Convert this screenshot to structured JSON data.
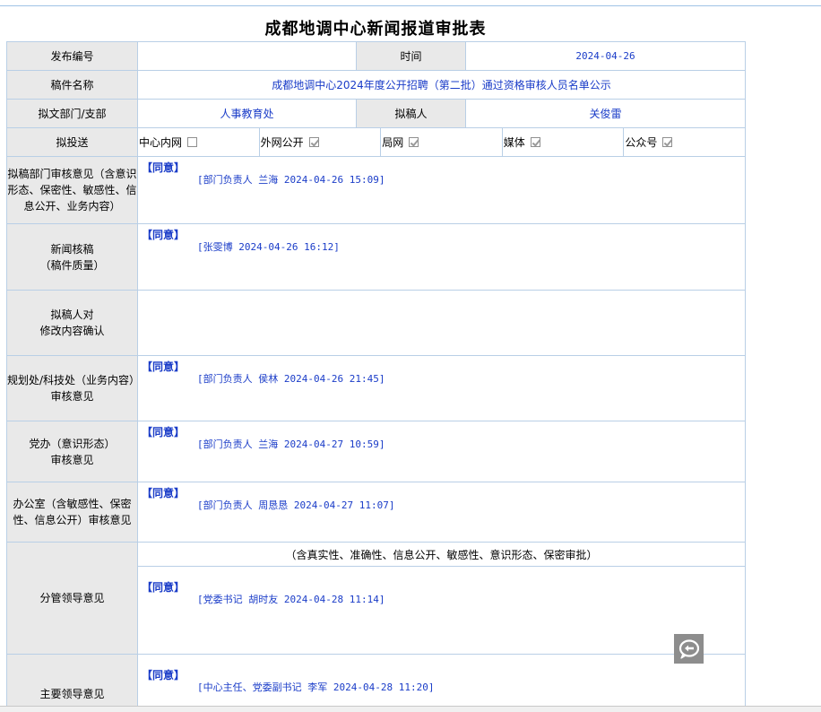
{
  "title": "成都地调中心新闻报道审批表",
  "labels": {
    "publish_no": "发布编号",
    "time": "时间",
    "manuscript_name": "稿件名称",
    "dept": "拟文部门/支部",
    "drafter": "拟稿人",
    "send_to": "拟投送",
    "dept_review": "拟稿部门审核意见（含意识形态、保密性、敏感性、信息公开、业务内容）",
    "news_review_1": "新闻核稿",
    "news_review_2": "（稿件质量）",
    "drafter_confirm_1": "拟稿人对",
    "drafter_confirm_2": "修改内容确认",
    "planning_review_1": "规划处/科技处（业务内容）",
    "planning_review_2": "审核意见",
    "party_review_1": "党办（意识形态）",
    "party_review_2": "审核意见",
    "office_review": "办公室（含敏感性、保密性、信息公开）审核意见",
    "leader_review": "分管领导意见",
    "main_leader_review": "主要领导意见"
  },
  "values": {
    "publish_no": "",
    "time": "2024-04-26",
    "manuscript_name": "成都地调中心2024年度公开招聘（第二批）通过资格审核人员名单公示",
    "dept": "人事教育处",
    "drafter": "关俊雷"
  },
  "send_targets": [
    {
      "label": "中心内网",
      "checked": false
    },
    {
      "label": "外网公开",
      "checked": true
    },
    {
      "label": "局网",
      "checked": true
    },
    {
      "label": "媒体",
      "checked": true
    },
    {
      "label": "公众号",
      "checked": true
    }
  ],
  "opinions": {
    "dept_review": {
      "verdict": "【同意】",
      "sign": "[部门负责人 兰海 2024-04-26 15:09]"
    },
    "news_review": {
      "verdict": "【同意】",
      "sign": "[张雯博 2024-04-26 16:12]"
    },
    "planning_review": {
      "verdict": "【同意】",
      "sign": "[部门负责人 侯林 2024-04-26 21:45]"
    },
    "party_review": {
      "verdict": "【同意】",
      "sign": "[部门负责人 兰海 2024-04-27 10:59]"
    },
    "office_review": {
      "verdict": "【同意】",
      "sign": "[部门负责人 周恳恳 2024-04-27 11:07]"
    },
    "leader_review": {
      "verdict": "【同意】",
      "sign": "[党委书记 胡时友 2024-04-28 11:14]"
    },
    "main_leader_review": {
      "verdict": "【同意】",
      "sign": "[中心主任、党委副书记 李军 2024-04-28 11:20]"
    }
  },
  "leader_note": "（含真实性、准确性、信息公开、敏感性、意识形态、保密审批）",
  "float_button_icon": "chat-return-icon",
  "colors": {
    "accent_text": "#1a3cc8",
    "label_bg": "#e9e9e9",
    "border": "#b9cfe6"
  }
}
